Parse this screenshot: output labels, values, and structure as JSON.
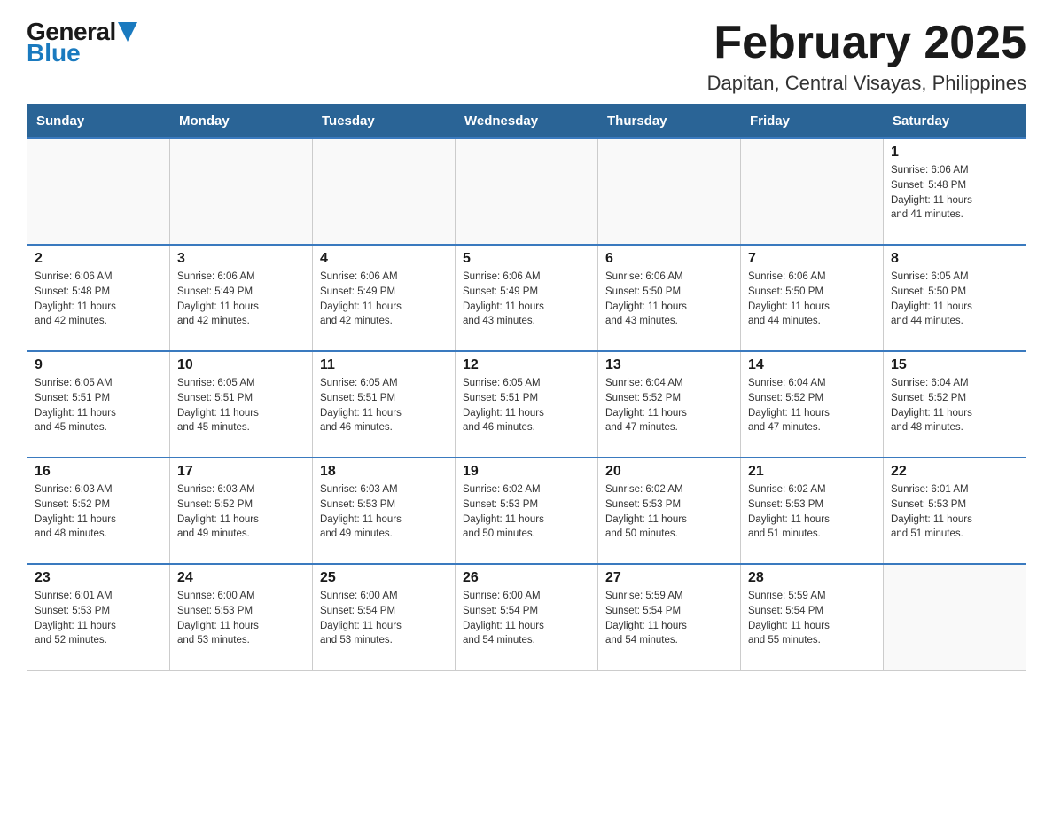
{
  "header": {
    "logo_general": "General",
    "logo_blue": "Blue",
    "title": "February 2025",
    "subtitle": "Dapitan, Central Visayas, Philippines"
  },
  "days_of_week": [
    "Sunday",
    "Monday",
    "Tuesday",
    "Wednesday",
    "Thursday",
    "Friday",
    "Saturday"
  ],
  "weeks": [
    [
      {
        "day": "",
        "info": ""
      },
      {
        "day": "",
        "info": ""
      },
      {
        "day": "",
        "info": ""
      },
      {
        "day": "",
        "info": ""
      },
      {
        "day": "",
        "info": ""
      },
      {
        "day": "",
        "info": ""
      },
      {
        "day": "1",
        "info": "Sunrise: 6:06 AM\nSunset: 5:48 PM\nDaylight: 11 hours\nand 41 minutes."
      }
    ],
    [
      {
        "day": "2",
        "info": "Sunrise: 6:06 AM\nSunset: 5:48 PM\nDaylight: 11 hours\nand 42 minutes."
      },
      {
        "day": "3",
        "info": "Sunrise: 6:06 AM\nSunset: 5:49 PM\nDaylight: 11 hours\nand 42 minutes."
      },
      {
        "day": "4",
        "info": "Sunrise: 6:06 AM\nSunset: 5:49 PM\nDaylight: 11 hours\nand 42 minutes."
      },
      {
        "day": "5",
        "info": "Sunrise: 6:06 AM\nSunset: 5:49 PM\nDaylight: 11 hours\nand 43 minutes."
      },
      {
        "day": "6",
        "info": "Sunrise: 6:06 AM\nSunset: 5:50 PM\nDaylight: 11 hours\nand 43 minutes."
      },
      {
        "day": "7",
        "info": "Sunrise: 6:06 AM\nSunset: 5:50 PM\nDaylight: 11 hours\nand 44 minutes."
      },
      {
        "day": "8",
        "info": "Sunrise: 6:05 AM\nSunset: 5:50 PM\nDaylight: 11 hours\nand 44 minutes."
      }
    ],
    [
      {
        "day": "9",
        "info": "Sunrise: 6:05 AM\nSunset: 5:51 PM\nDaylight: 11 hours\nand 45 minutes."
      },
      {
        "day": "10",
        "info": "Sunrise: 6:05 AM\nSunset: 5:51 PM\nDaylight: 11 hours\nand 45 minutes."
      },
      {
        "day": "11",
        "info": "Sunrise: 6:05 AM\nSunset: 5:51 PM\nDaylight: 11 hours\nand 46 minutes."
      },
      {
        "day": "12",
        "info": "Sunrise: 6:05 AM\nSunset: 5:51 PM\nDaylight: 11 hours\nand 46 minutes."
      },
      {
        "day": "13",
        "info": "Sunrise: 6:04 AM\nSunset: 5:52 PM\nDaylight: 11 hours\nand 47 minutes."
      },
      {
        "day": "14",
        "info": "Sunrise: 6:04 AM\nSunset: 5:52 PM\nDaylight: 11 hours\nand 47 minutes."
      },
      {
        "day": "15",
        "info": "Sunrise: 6:04 AM\nSunset: 5:52 PM\nDaylight: 11 hours\nand 48 minutes."
      }
    ],
    [
      {
        "day": "16",
        "info": "Sunrise: 6:03 AM\nSunset: 5:52 PM\nDaylight: 11 hours\nand 48 minutes."
      },
      {
        "day": "17",
        "info": "Sunrise: 6:03 AM\nSunset: 5:52 PM\nDaylight: 11 hours\nand 49 minutes."
      },
      {
        "day": "18",
        "info": "Sunrise: 6:03 AM\nSunset: 5:53 PM\nDaylight: 11 hours\nand 49 minutes."
      },
      {
        "day": "19",
        "info": "Sunrise: 6:02 AM\nSunset: 5:53 PM\nDaylight: 11 hours\nand 50 minutes."
      },
      {
        "day": "20",
        "info": "Sunrise: 6:02 AM\nSunset: 5:53 PM\nDaylight: 11 hours\nand 50 minutes."
      },
      {
        "day": "21",
        "info": "Sunrise: 6:02 AM\nSunset: 5:53 PM\nDaylight: 11 hours\nand 51 minutes."
      },
      {
        "day": "22",
        "info": "Sunrise: 6:01 AM\nSunset: 5:53 PM\nDaylight: 11 hours\nand 51 minutes."
      }
    ],
    [
      {
        "day": "23",
        "info": "Sunrise: 6:01 AM\nSunset: 5:53 PM\nDaylight: 11 hours\nand 52 minutes."
      },
      {
        "day": "24",
        "info": "Sunrise: 6:00 AM\nSunset: 5:53 PM\nDaylight: 11 hours\nand 53 minutes."
      },
      {
        "day": "25",
        "info": "Sunrise: 6:00 AM\nSunset: 5:54 PM\nDaylight: 11 hours\nand 53 minutes."
      },
      {
        "day": "26",
        "info": "Sunrise: 6:00 AM\nSunset: 5:54 PM\nDaylight: 11 hours\nand 54 minutes."
      },
      {
        "day": "27",
        "info": "Sunrise: 5:59 AM\nSunset: 5:54 PM\nDaylight: 11 hours\nand 54 minutes."
      },
      {
        "day": "28",
        "info": "Sunrise: 5:59 AM\nSunset: 5:54 PM\nDaylight: 11 hours\nand 55 minutes."
      },
      {
        "day": "",
        "info": ""
      }
    ]
  ]
}
